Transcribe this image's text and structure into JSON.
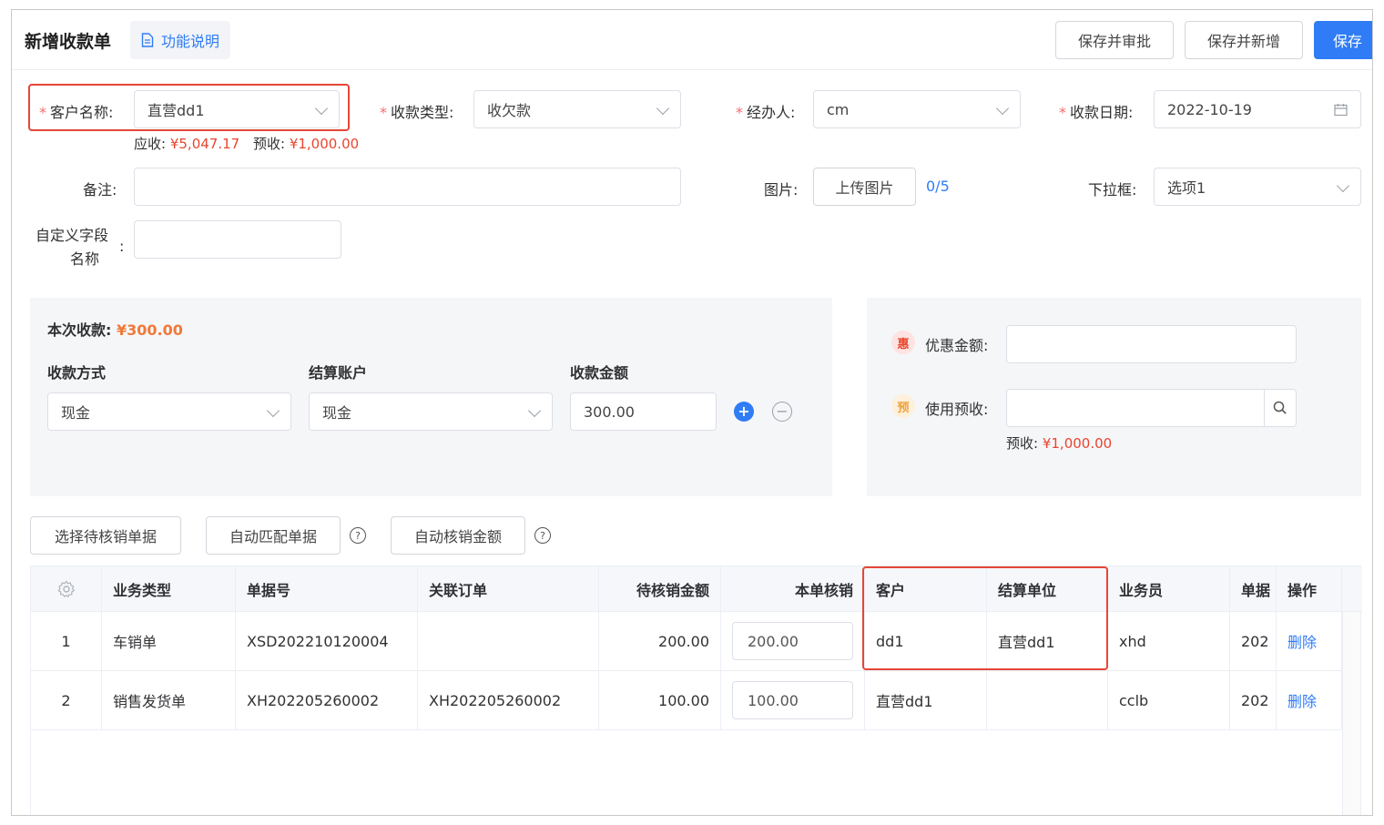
{
  "header": {
    "title": "新增收款单",
    "help_label": "功能说明",
    "btn_save_approve": "保存并审批",
    "btn_save_new": "保存并新增",
    "btn_save": "保存"
  },
  "form": {
    "customer": {
      "label": "客户名称:",
      "value": "直营dd1"
    },
    "receivable_label": "应收:",
    "receivable_value": "¥5,047.17",
    "prepaid_label": "预收:",
    "prepaid_value": "¥1,000.00",
    "collection_type": {
      "label": "收款类型:",
      "value": "收欠款"
    },
    "handler": {
      "label": "经办人:",
      "value": "cm"
    },
    "date": {
      "label": "收款日期:",
      "value": "2022-10-19"
    },
    "remark": {
      "label": "备注:",
      "value": ""
    },
    "image": {
      "label": "图片:",
      "upload_label": "上传图片",
      "count": "0/5"
    },
    "dropdown": {
      "label": "下拉框:",
      "value": "选项1"
    },
    "custom_field": {
      "label_line1": "自定义字段",
      "label_line2": "名称",
      "value": ""
    }
  },
  "payment": {
    "this_label": "本次收款:",
    "this_value": "¥300.00",
    "method_header": "收款方式",
    "account_header": "结算账户",
    "amount_header": "收款金额",
    "method_value": "现金",
    "account_value": "现金",
    "amount_value": "300.00"
  },
  "discount": {
    "discount_icon": "惠",
    "discount_label": "优惠金额:",
    "prepaid_icon": "预",
    "prepaid_label": "使用预收:",
    "prepaid_note_label": "预收:",
    "prepaid_note_value": "¥1,000.00"
  },
  "actions": {
    "select_docs": "选择待核销单据",
    "auto_match": "自动匹配单据",
    "auto_amount": "自动核销金额"
  },
  "table": {
    "headers": [
      "业务类型",
      "单据号",
      "关联订单",
      "待核销金额",
      "本单核销",
      "客户",
      "结算单位",
      "业务员",
      "单据",
      "操作"
    ],
    "rows": [
      {
        "index": "1",
        "type": "车销单",
        "doc_no": "XSD202210120004",
        "order": "",
        "pending": "200.00",
        "writeoff": "200.00",
        "customer": "dd1",
        "settle": "直营dd1",
        "salesman": "xhd",
        "date": "202",
        "action": "删除"
      },
      {
        "index": "2",
        "type": "销售发货单",
        "doc_no": "XH202205260002",
        "order": "XH202205260002",
        "pending": "100.00",
        "writeoff": "100.00",
        "customer": "直营dd1",
        "settle": "",
        "salesman": "cclb",
        "date": "202",
        "action": "删除"
      }
    ]
  },
  "colors": {
    "accent": "#2f7cf6",
    "danger": "#e8452f",
    "highlight": "#e64637"
  }
}
